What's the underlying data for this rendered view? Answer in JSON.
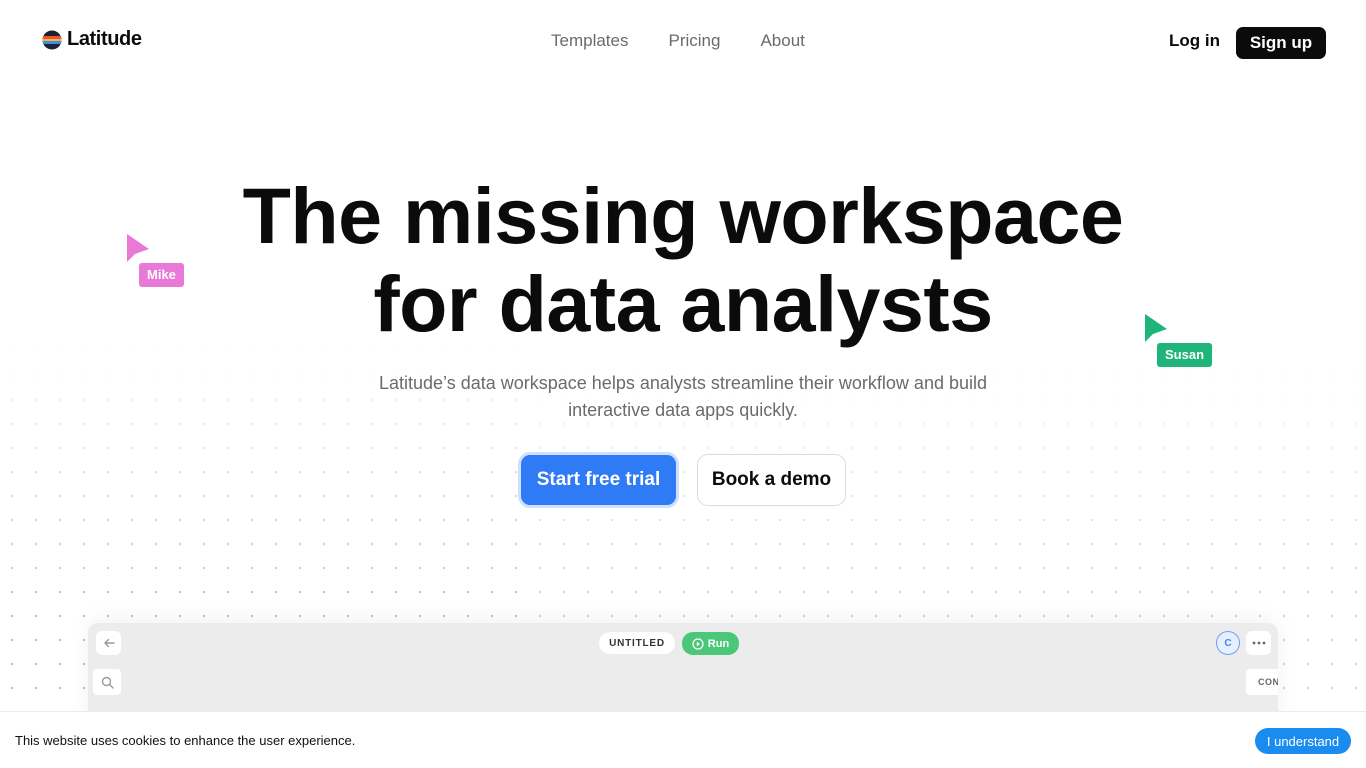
{
  "brand": {
    "name": "Latitude"
  },
  "nav": {
    "items": [
      "Templates",
      "Pricing",
      "About"
    ],
    "login": "Log in",
    "signup": "Sign up"
  },
  "hero": {
    "headline_line1": "The missing workspace",
    "headline_line2": "for data analysts",
    "subhead_line1": "Latitude’s data workspace helps analysts streamline their workflow and build",
    "subhead_line2": "interactive data apps quickly.",
    "primary_cta": "Start free trial",
    "secondary_cta": "Book a demo"
  },
  "cursors": [
    {
      "name": "Mike",
      "color": "#e879d6"
    },
    {
      "name": "Susan",
      "color": "#1fb57a"
    }
  ],
  "preview": {
    "title": "UNTITLED",
    "run_label": "Run",
    "avatar_initial": "C",
    "panel_tab": "CON"
  },
  "cookie": {
    "text": "This website uses cookies to enhance the user experience.",
    "button": "I understand"
  },
  "colors": {
    "primary": "#2f7bf5",
    "run": "#4cc77a",
    "cookie_button": "#1a8cf0"
  }
}
